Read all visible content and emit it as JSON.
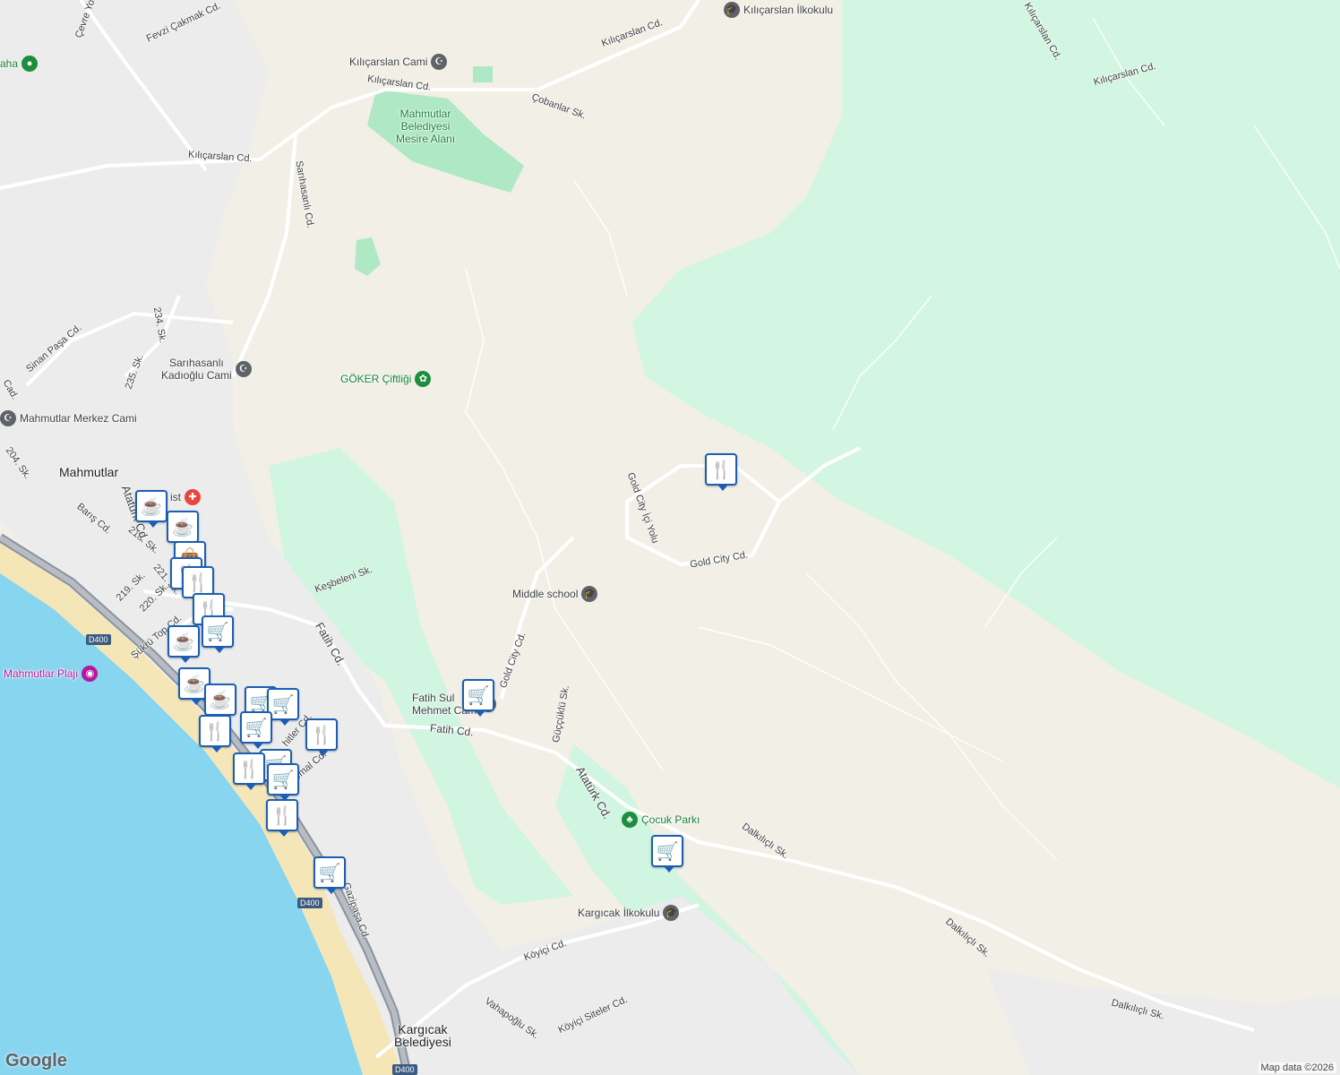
{
  "map": {
    "colors": {
      "land": "#f2efe6",
      "forest": "#d0f5e0",
      "park": "#bdebcd",
      "water": "#88d5f0",
      "urban": "#ececec",
      "road": "#ffffff",
      "highway": "#9aa0a6",
      "beach": "#f5e6b8"
    },
    "places": [
      {
        "id": "mahmutlar",
        "text": "Mahmutlar"
      },
      {
        "id": "kargicak-bel",
        "text": "Kargıcak\nBelediyesi"
      }
    ],
    "pois": [
      {
        "id": "kilicarslan-ilkokulu",
        "text": "Kılıçarslan İlkokulu",
        "icon": "school-icon"
      },
      {
        "id": "kilicarslan-cami",
        "text": "Kılıçarslan Cami",
        "icon": "mosque-icon"
      },
      {
        "id": "mesire",
        "text": "Mahmutlar\nBelediyesi\nMesire Alanı",
        "icon": ""
      },
      {
        "id": "sarihasanli-cami",
        "text": "Sarıhasanlı\nKadıoğlu Cami",
        "icon": "mosque-icon"
      },
      {
        "id": "goker",
        "text": "GÖKER Çiftliği",
        "icon": "flower-icon"
      },
      {
        "id": "merkez-cami",
        "text": "Mahmutlar Merkez Cami",
        "icon": "mosque-icon"
      },
      {
        "id": "middle-school",
        "text": "Middle school",
        "icon": "school-icon"
      },
      {
        "id": "fatih-cami",
        "text": "Fatih Sul\nMehmet Cam",
        "icon": "mosque-icon"
      },
      {
        "id": "cocuk-parki",
        "text": "Çocuk Parkı",
        "icon": "tree-icon"
      },
      {
        "id": "kargicak-ilkokulu",
        "text": "Kargıcak İlkokulu",
        "icon": "school-icon"
      },
      {
        "id": "plaji",
        "text": "Mahmutlar Plajı",
        "icon": "camera-icon"
      },
      {
        "id": "aha",
        "text": "aha",
        "icon": "pin-icon"
      },
      {
        "id": "hospital",
        "text": "ist",
        "icon": "hospital-icon"
      }
    ],
    "roads": [
      {
        "id": "r1",
        "text": "Kılıçarslan Cd."
      },
      {
        "id": "r2",
        "text": "Kılıçarslan Cd."
      },
      {
        "id": "r3",
        "text": "Kılıçarslan Cd."
      },
      {
        "id": "r4",
        "text": "Kılıçarslan Cd."
      },
      {
        "id": "r5",
        "text": "Kılıçarslan Cd."
      },
      {
        "id": "r6",
        "text": "Fevzi Çakmak Cd."
      },
      {
        "id": "r7",
        "text": "Çobanlar Sk."
      },
      {
        "id": "r8",
        "text": "Sarıhasanlı Cd."
      },
      {
        "id": "r9",
        "text": "234. Sk."
      },
      {
        "id": "r10",
        "text": "235. Sk."
      },
      {
        "id": "r11",
        "text": "Sinan Paşa Cd."
      },
      {
        "id": "r12",
        "text": "Gold City İçi Yolu"
      },
      {
        "id": "r13",
        "text": "Gold City Cd."
      },
      {
        "id": "r14",
        "text": "Keşbeleni Sk."
      },
      {
        "id": "r15",
        "text": "Fatih Cd."
      },
      {
        "id": "r16",
        "text": "Fatih Cd."
      },
      {
        "id": "r17",
        "text": "Gold City Cd."
      },
      {
        "id": "r18",
        "text": "Güççüklü Sk."
      },
      {
        "id": "r19",
        "text": "Atatürk Cd."
      },
      {
        "id": "r20",
        "text": "Dalkılıçlı Sk."
      },
      {
        "id": "r21",
        "text": "Dalkılıçlı Sk."
      },
      {
        "id": "r22",
        "text": "Dalkılıçlı Sk."
      },
      {
        "id": "r23",
        "text": "Köyiçi Cd."
      },
      {
        "id": "r24",
        "text": "Köyiçi Siteler Cd."
      },
      {
        "id": "r25",
        "text": "Vahapoğlu Sk."
      },
      {
        "id": "r26",
        "text": "Gazipaşa Cd."
      },
      {
        "id": "r27",
        "text": "Barış Cd."
      },
      {
        "id": "r28",
        "text": "218. Sk."
      },
      {
        "id": "r29",
        "text": "219. Sk."
      },
      {
        "id": "r30",
        "text": "220. Sk."
      },
      {
        "id": "r31",
        "text": "221. Sk."
      },
      {
        "id": "r32",
        "text": "Şükrü Top Cd."
      },
      {
        "id": "r33",
        "text": "Çevre Yolu"
      },
      {
        "id": "r34",
        "text": "Atatürk Cd."
      },
      {
        "id": "r35",
        "text": "204. Sk."
      },
      {
        "id": "r36",
        "text": "Cad."
      },
      {
        "id": "r37",
        "text": "Kemal Cd."
      },
      {
        "id": "r38",
        "text": "hitler Cd."
      }
    ],
    "shields": [
      "D400",
      "D400",
      "D400"
    ],
    "markers": [
      {
        "type": "restaurant",
        "icon": "fork-knife-icon"
      },
      {
        "type": "grocery",
        "icon": "cart-icon"
      },
      {
        "type": "grocery",
        "icon": "cart-icon"
      },
      {
        "type": "cafe",
        "icon": "coffee-icon"
      },
      {
        "type": "cafe",
        "icon": "coffee-icon"
      },
      {
        "type": "shopping",
        "icon": "bag-icon"
      },
      {
        "type": "restaurant",
        "icon": "fork-knife-icon"
      },
      {
        "type": "restaurant",
        "icon": "fork-knife-icon"
      },
      {
        "type": "restaurant",
        "icon": "fork-knife-icon"
      },
      {
        "type": "grocery",
        "icon": "cart-icon"
      },
      {
        "type": "cafe",
        "icon": "coffee-icon"
      },
      {
        "type": "cafe",
        "icon": "coffee-icon"
      },
      {
        "type": "cafe",
        "icon": "coffee-icon"
      },
      {
        "type": "grocery",
        "icon": "cart-icon"
      },
      {
        "type": "grocery",
        "icon": "cart-icon"
      },
      {
        "type": "grocery",
        "icon": "cart-icon"
      },
      {
        "type": "restaurant",
        "icon": "fork-knife-icon"
      },
      {
        "type": "restaurant",
        "icon": "fork-knife-icon"
      },
      {
        "type": "grocery",
        "icon": "cart-icon"
      },
      {
        "type": "restaurant",
        "icon": "fork-knife-icon"
      },
      {
        "type": "grocery",
        "icon": "cart-icon"
      },
      {
        "type": "restaurant",
        "icon": "fork-knife-icon"
      },
      {
        "type": "grocery",
        "icon": "cart-icon"
      }
    ],
    "attribution": "Map data ©2026",
    "logo": "Google"
  }
}
